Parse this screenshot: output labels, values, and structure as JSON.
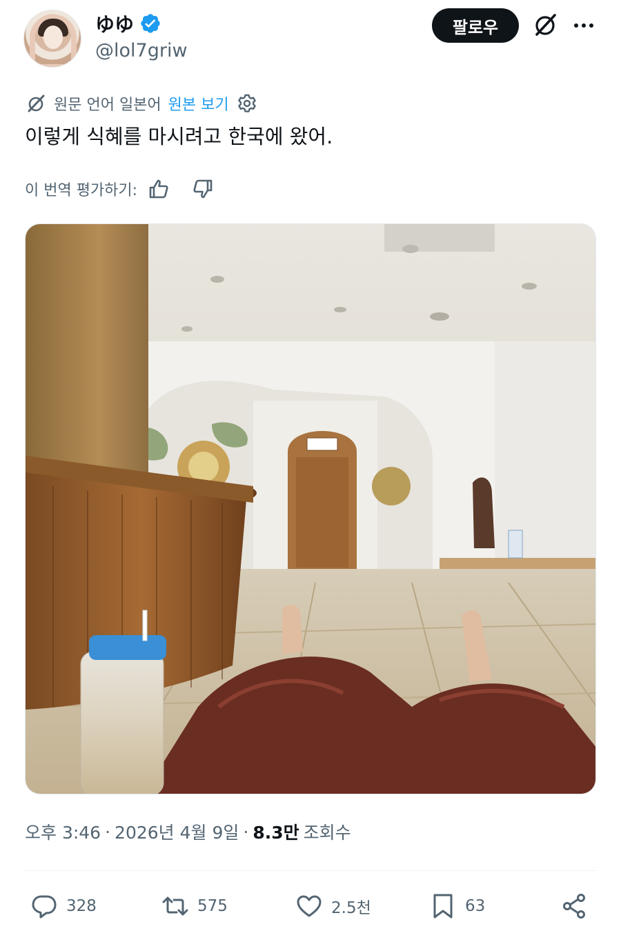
{
  "author": {
    "display_name": "ゆゆ",
    "handle": "@lol7griw",
    "verified": true,
    "avatar_icon": "avatar-photo"
  },
  "header": {
    "follow_label": "팔로우",
    "grok_icon": "grok-icon",
    "more_icon": "more-dots-icon"
  },
  "translation": {
    "icon": "grok-translate-icon",
    "source_label": "원문 언어 일본어",
    "view_original_label": "원본 보기",
    "settings_icon": "gear-icon"
  },
  "tweet": {
    "text": "이렇게 식혜를 마시려고 한국에 왔어."
  },
  "rating": {
    "label": "이 번역 평가하기:",
    "up_icon": "thumbs-up-icon",
    "down_icon": "thumbs-down-icon"
  },
  "meta": {
    "time": "오후 3:46",
    "separator": "·",
    "date": "2026년 4월 9일",
    "views_count": "8.3만",
    "views_label": "조회수"
  },
  "actions": {
    "replies": "328",
    "reposts": "575",
    "likes": "2.5천",
    "bookmarks": "63"
  },
  "colors": {
    "accent": "#1d9bf0",
    "text": "#0f1419",
    "secondary": "#536471"
  }
}
